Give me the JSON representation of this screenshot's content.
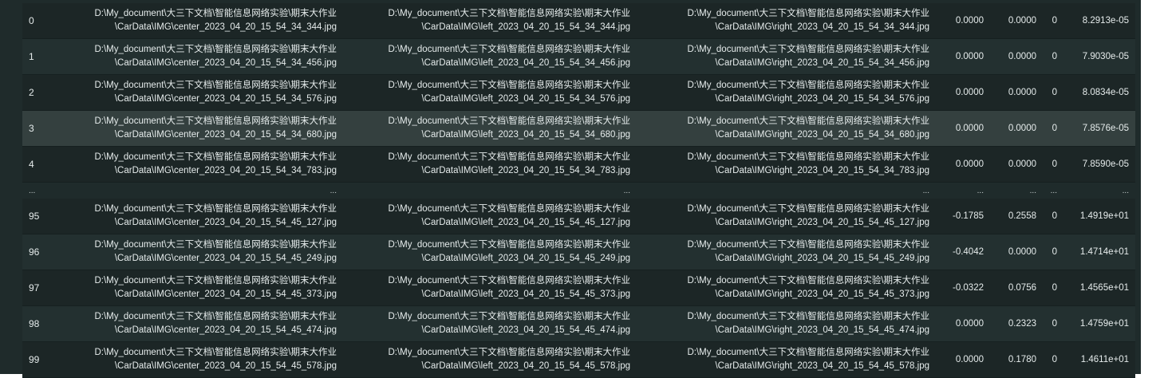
{
  "table": {
    "rows": [
      {
        "index": "0",
        "center": [
          "D:\\My_document\\大三下文档\\智能信息网络实验\\期末大作业",
          "\\CarData\\IMG\\center_2023_04_20_15_54_34_344.jpg"
        ],
        "left": [
          "D:\\My_document\\大三下文档\\智能信息网络实验\\期末大作业",
          "\\CarData\\IMG\\left_2023_04_20_15_54_34_344.jpg"
        ],
        "right": [
          "D:\\My_document\\大三下文档\\智能信息网络实验\\期末大作业",
          "\\CarData\\IMG\\right_2023_04_20_15_54_34_344.jpg"
        ],
        "v1": "0.0000",
        "v2": "0.0000",
        "v3": "0",
        "v4": "8.2913e-05"
      },
      {
        "index": "1",
        "center": [
          "D:\\My_document\\大三下文档\\智能信息网络实验\\期末大作业",
          "\\CarData\\IMG\\center_2023_04_20_15_54_34_456.jpg"
        ],
        "left": [
          "D:\\My_document\\大三下文档\\智能信息网络实验\\期末大作业",
          "\\CarData\\IMG\\left_2023_04_20_15_54_34_456.jpg"
        ],
        "right": [
          "D:\\My_document\\大三下文档\\智能信息网络实验\\期末大作业",
          "\\CarData\\IMG\\right_2023_04_20_15_54_34_456.jpg"
        ],
        "v1": "0.0000",
        "v2": "0.0000",
        "v3": "0",
        "v4": "7.9030e-05"
      },
      {
        "index": "2",
        "center": [
          "D:\\My_document\\大三下文档\\智能信息网络实验\\期末大作业",
          "\\CarData\\IMG\\center_2023_04_20_15_54_34_576.jpg"
        ],
        "left": [
          "D:\\My_document\\大三下文档\\智能信息网络实验\\期末大作业",
          "\\CarData\\IMG\\left_2023_04_20_15_54_34_576.jpg"
        ],
        "right": [
          "D:\\My_document\\大三下文档\\智能信息网络实验\\期末大作业",
          "\\CarData\\IMG\\right_2023_04_20_15_54_34_576.jpg"
        ],
        "v1": "0.0000",
        "v2": "0.0000",
        "v3": "0",
        "v4": "8.0834e-05"
      },
      {
        "index": "3",
        "center": [
          "D:\\My_document\\大三下文档\\智能信息网络实验\\期末大作业",
          "\\CarData\\IMG\\center_2023_04_20_15_54_34_680.jpg"
        ],
        "left": [
          "D:\\My_document\\大三下文档\\智能信息网络实验\\期末大作业",
          "\\CarData\\IMG\\left_2023_04_20_15_54_34_680.jpg"
        ],
        "right": [
          "D:\\My_document\\大三下文档\\智能信息网络实验\\期末大作业",
          "\\CarData\\IMG\\right_2023_04_20_15_54_34_680.jpg"
        ],
        "v1": "0.0000",
        "v2": "0.0000",
        "v3": "0",
        "v4": "7.8576e-05"
      },
      {
        "index": "4",
        "center": [
          "D:\\My_document\\大三下文档\\智能信息网络实验\\期末大作业",
          "\\CarData\\IMG\\center_2023_04_20_15_54_34_783.jpg"
        ],
        "left": [
          "D:\\My_document\\大三下文档\\智能信息网络实验\\期末大作业",
          "\\CarData\\IMG\\left_2023_04_20_15_54_34_783.jpg"
        ],
        "right": [
          "D:\\My_document\\大三下文档\\智能信息网络实验\\期末大作业",
          "\\CarData\\IMG\\right_2023_04_20_15_54_34_783.jpg"
        ],
        "v1": "0.0000",
        "v2": "0.0000",
        "v3": "0",
        "v4": "7.8590e-05"
      },
      {
        "ellipsis": true,
        "index": "...",
        "center": [
          "..."
        ],
        "left": [
          "..."
        ],
        "right": [
          "..."
        ],
        "v1": "...",
        "v2": "...",
        "v3": "...",
        "v4": "..."
      },
      {
        "index": "95",
        "center": [
          "D:\\My_document\\大三下文档\\智能信息网络实验\\期末大作业",
          "\\CarData\\IMG\\center_2023_04_20_15_54_45_127.jpg"
        ],
        "left": [
          "D:\\My_document\\大三下文档\\智能信息网络实验\\期末大作业",
          "\\CarData\\IMG\\left_2023_04_20_15_54_45_127.jpg"
        ],
        "right": [
          "D:\\My_document\\大三下文档\\智能信息网络实验\\期末大作业",
          "\\CarData\\IMG\\right_2023_04_20_15_54_45_127.jpg"
        ],
        "v1": "-0.1785",
        "v2": "0.2558",
        "v3": "0",
        "v4": "1.4919e+01"
      },
      {
        "index": "96",
        "center": [
          "D:\\My_document\\大三下文档\\智能信息网络实验\\期末大作业",
          "\\CarData\\IMG\\center_2023_04_20_15_54_45_249.jpg"
        ],
        "left": [
          "D:\\My_document\\大三下文档\\智能信息网络实验\\期末大作业",
          "\\CarData\\IMG\\left_2023_04_20_15_54_45_249.jpg"
        ],
        "right": [
          "D:\\My_document\\大三下文档\\智能信息网络实验\\期末大作业",
          "\\CarData\\IMG\\right_2023_04_20_15_54_45_249.jpg"
        ],
        "v1": "-0.4042",
        "v2": "0.0000",
        "v3": "0",
        "v4": "1.4714e+01"
      },
      {
        "index": "97",
        "center": [
          "D:\\My_document\\大三下文档\\智能信息网络实验\\期末大作业",
          "\\CarData\\IMG\\center_2023_04_20_15_54_45_373.jpg"
        ],
        "left": [
          "D:\\My_document\\大三下文档\\智能信息网络实验\\期末大作业",
          "\\CarData\\IMG\\left_2023_04_20_15_54_45_373.jpg"
        ],
        "right": [
          "D:\\My_document\\大三下文档\\智能信息网络实验\\期末大作业",
          "\\CarData\\IMG\\right_2023_04_20_15_54_45_373.jpg"
        ],
        "v1": "-0.0322",
        "v2": "0.0756",
        "v3": "0",
        "v4": "1.4565e+01"
      },
      {
        "index": "98",
        "center": [
          "D:\\My_document\\大三下文档\\智能信息网络实验\\期末大作业",
          "\\CarData\\IMG\\center_2023_04_20_15_54_45_474.jpg"
        ],
        "left": [
          "D:\\My_document\\大三下文档\\智能信息网络实验\\期末大作业",
          "\\CarData\\IMG\\left_2023_04_20_15_54_45_474.jpg"
        ],
        "right": [
          "D:\\My_document\\大三下文档\\智能信息网络实验\\期末大作业",
          "\\CarData\\IMG\\right_2023_04_20_15_54_45_474.jpg"
        ],
        "v1": "0.0000",
        "v2": "0.2323",
        "v3": "0",
        "v4": "1.4759e+01"
      },
      {
        "index": "99",
        "center": [
          "D:\\My_document\\大三下文档\\智能信息网络实验\\期末大作业",
          "\\CarData\\IMG\\center_2023_04_20_15_54_45_578.jpg"
        ],
        "left": [
          "D:\\My_document\\大三下文档\\智能信息网络实验\\期末大作业",
          "\\CarData\\IMG\\left_2023_04_20_15_54_45_578.jpg"
        ],
        "right": [
          "D:\\My_document\\大三下文档\\智能信息网络实验\\期末大作业",
          "\\CarData\\IMG\\right_2023_04_20_15_54_45_578.jpg"
        ],
        "v1": "0.0000",
        "v2": "0.1780",
        "v3": "0",
        "v4": "1.4611e+01"
      }
    ]
  },
  "colors": {
    "background": "#1f2b2b",
    "row_hover": "#34403f",
    "text": "#e6ecec"
  }
}
